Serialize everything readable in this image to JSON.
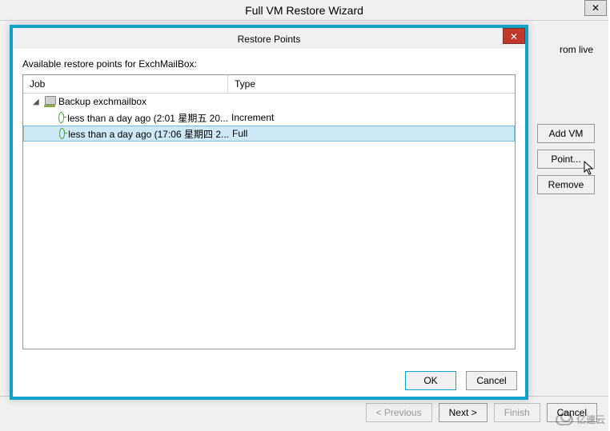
{
  "wizard": {
    "title": "Full VM Restore Wizard",
    "peek_text": "rom live",
    "buttons": {
      "add_vm": "Add VM",
      "point": "Point...",
      "remove": "Remove",
      "previous": "< Previous",
      "next": "Next >",
      "finish": "Finish",
      "cancel": "Cancel"
    }
  },
  "modal": {
    "title": "Restore Points",
    "hint": "Available restore points for ExchMailBox:",
    "columns": {
      "job": "Job",
      "type": "Type"
    },
    "parent": {
      "label": "Backup exchmailbox"
    },
    "points": [
      {
        "label": "less than a day ago (2:01 星期五 20...",
        "type": "Increment",
        "selected": false
      },
      {
        "label": "less than a day ago (17:06 星期四 2...",
        "type": "Full",
        "selected": true
      }
    ],
    "ok": "OK",
    "cancel": "Cancel"
  },
  "watermark": "亿速云"
}
